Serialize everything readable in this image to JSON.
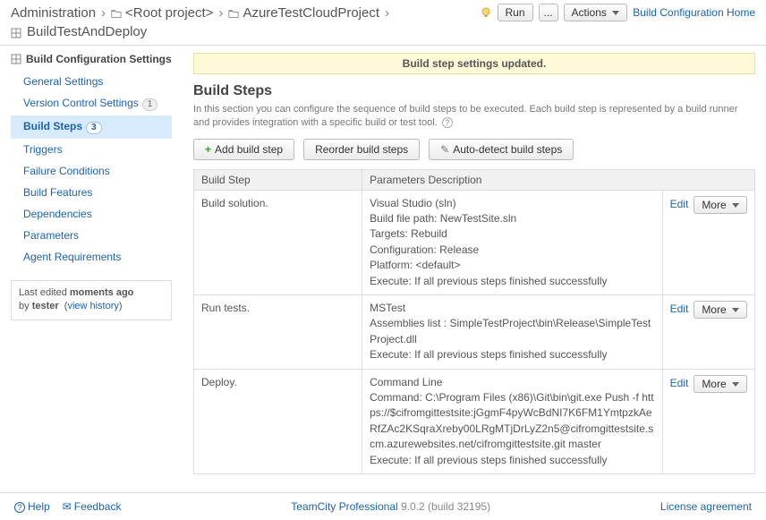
{
  "breadcrumb": {
    "admin": "Administration",
    "root": "<Root project>",
    "project": "AzureTestCloudProject",
    "build_config": "BuildTestAndDeploy"
  },
  "header_right": {
    "run": "Run",
    "run_more": "...",
    "actions": "Actions",
    "home": "Build Configuration Home"
  },
  "sidebar": {
    "title": "Build Configuration Settings",
    "items": [
      {
        "label": "General Settings",
        "badge": "",
        "active": false
      },
      {
        "label": "Version Control Settings",
        "badge": "1",
        "active": false
      },
      {
        "label": "Build Steps",
        "badge": "3",
        "active": true
      },
      {
        "label": "Triggers",
        "badge": "",
        "active": false
      },
      {
        "label": "Failure Conditions",
        "badge": "",
        "active": false
      },
      {
        "label": "Build Features",
        "badge": "",
        "active": false
      },
      {
        "label": "Dependencies",
        "badge": "",
        "active": false
      },
      {
        "label": "Parameters",
        "badge": "",
        "active": false
      },
      {
        "label": "Agent Requirements",
        "badge": "",
        "active": false
      }
    ],
    "edit_prefix": "Last edited ",
    "edit_when": "moments ago",
    "edit_by": " by ",
    "edit_user": "tester",
    "edit_history": "view history"
  },
  "banner": "Build step settings updated.",
  "main": {
    "title": "Build Steps",
    "desc": "In this section you can configure the sequence of build steps to be executed. Each build step is represented by a build runner and provides integration with a specific build or test tool."
  },
  "toolbar": {
    "add": "Add build step",
    "reorder": "Reorder build steps",
    "auto": "Auto-detect build steps"
  },
  "table": {
    "col1": "Build Step",
    "col2": "Parameters Description",
    "edit": "Edit",
    "more": "More",
    "rows": [
      {
        "name": "Build solution.",
        "params": "Visual Studio (sln)\nBuild file path: NewTestSite.sln\nTargets: Rebuild\nConfiguration: Release\nPlatform: <default>\nExecute: If all previous steps finished successfully"
      },
      {
        "name": "Run tests.",
        "params": "MSTest\nAssemblies list : SimpleTestProject\\bin\\Release\\SimpleTestProject.dll\nExecute: If all previous steps finished successfully"
      },
      {
        "name": "Deploy.",
        "params": "Command Line\nCommand: C:\\Program Files (x86)\\Git\\bin\\git.exe Push -f https://$cifromgittestsite:jGgmF4pyWcBdNI7K6FM1YmtpzkAeRfZAc2KSqraXreby00LRgMTjDrLyZ2n5@cifromgittestsite.scm.azurewebsites.net/cifromgittestsite.git master\nExecute: If all previous steps finished successfully"
      }
    ]
  },
  "footer": {
    "help": "Help",
    "feedback": "Feedback",
    "product": "TeamCity Professional",
    "version": " 9.0.2 (build 32195)",
    "license": "License agreement"
  }
}
